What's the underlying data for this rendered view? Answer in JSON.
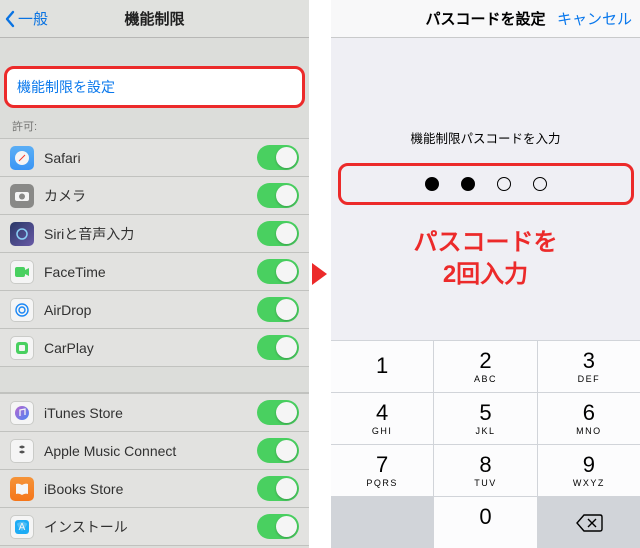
{
  "left": {
    "back_label": "一般",
    "title": "機能制限",
    "setup_label": "機能制限を設定",
    "allow_label": "許可:",
    "group1": [
      {
        "icon": "safari-icon",
        "label": "Safari"
      },
      {
        "icon": "camera-icon",
        "label": "カメラ"
      },
      {
        "icon": "siri-icon",
        "label": "Siriと音声入力"
      },
      {
        "icon": "facetime-icon",
        "label": "FaceTime"
      },
      {
        "icon": "airdrop-icon",
        "label": "AirDrop"
      },
      {
        "icon": "carplay-icon",
        "label": "CarPlay"
      }
    ],
    "group2": [
      {
        "icon": "itunes-icon",
        "label": "iTunes Store"
      },
      {
        "icon": "applemusic-icon",
        "label": "Apple Music Connect"
      },
      {
        "icon": "ibooks-icon",
        "label": "iBooks Store"
      },
      {
        "icon": "install-icon",
        "label": "インストール"
      }
    ]
  },
  "right": {
    "title": "パスコードを設定",
    "cancel": "キャンセル",
    "prompt": "機能制限パスコードを入力",
    "dots_filled": 2,
    "dots_total": 4,
    "annotation_line1": "パスコードを",
    "annotation_line2": "2回入力",
    "keys": [
      {
        "n": "1",
        "l": ""
      },
      {
        "n": "2",
        "l": "ABC"
      },
      {
        "n": "3",
        "l": "DEF"
      },
      {
        "n": "4",
        "l": "GHI"
      },
      {
        "n": "5",
        "l": "JKL"
      },
      {
        "n": "6",
        "l": "MNO"
      },
      {
        "n": "7",
        "l": "PQRS"
      },
      {
        "n": "8",
        "l": "TUV"
      },
      {
        "n": "9",
        "l": "WXYZ"
      },
      {
        "n": "",
        "l": ""
      },
      {
        "n": "0",
        "l": ""
      },
      {
        "n": "",
        "l": ""
      }
    ]
  }
}
